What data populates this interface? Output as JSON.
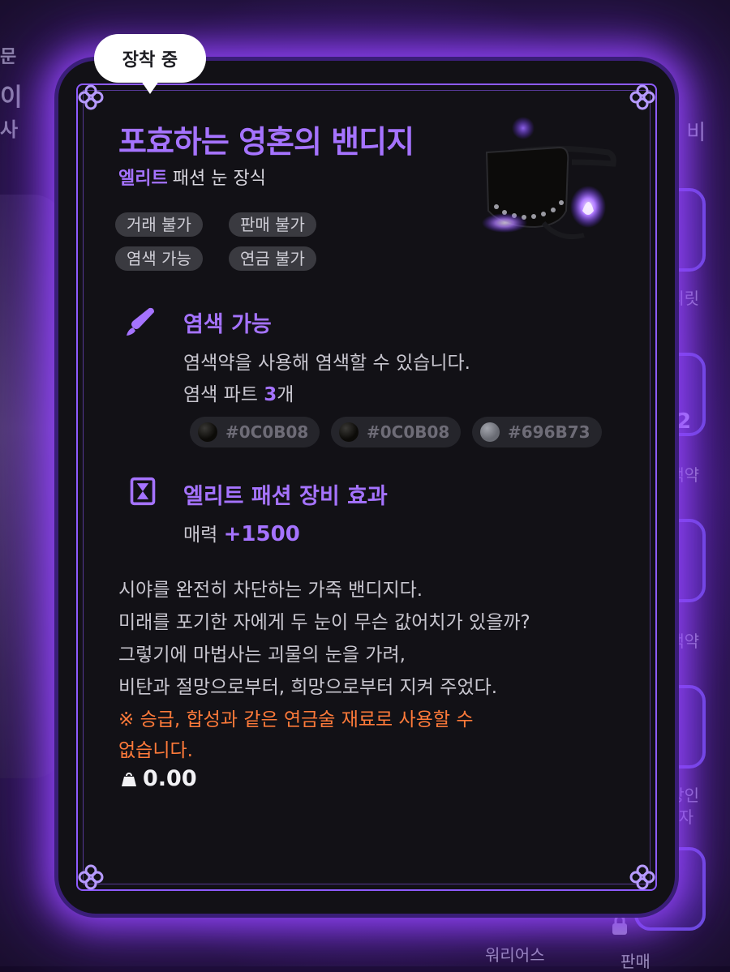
{
  "equip_badge": "장착 중",
  "item": {
    "name": "포효하는 영혼의 밴디지",
    "grade": "엘리트",
    "category": "패션 눈 장식",
    "tags": [
      "거래 불가",
      "판매 불가",
      "염색 가능",
      "연금 불가"
    ]
  },
  "dye": {
    "title": "염색 가능",
    "desc": "염색약을 사용해 염색할 수 있습니다.",
    "parts_prefix": "염색 파트",
    "parts_count": "3",
    "parts_suffix": "개",
    "colors": [
      {
        "hex": "#0C0B08",
        "label": "#0C0B08"
      },
      {
        "hex": "#0C0B08",
        "label": "#0C0B08"
      },
      {
        "hex": "#696B73",
        "label": "#696B73"
      }
    ]
  },
  "effect": {
    "title": "엘리트 패션 장비 효과",
    "stat_label": "매력",
    "stat_value": "+1500"
  },
  "description": [
    "시야를 완전히 차단하는 가죽 밴디지다.",
    "미래를 포기한 자에게 두 눈이 무슨 값어치가 있을까?",
    "그렇기에 마법사는 괴물의 눈을 가려,",
    "비탄과 절망으로부터, 희망으로부터 지켜 주었다."
  ],
  "warning": [
    "※ 승급, 합성과 같은 연금술 재료로 사용할 수",
    "없습니다."
  ],
  "weight": "0.00",
  "background": {
    "left_text": [
      "문",
      "이",
      "사"
    ],
    "right_text": [
      "비",
      "리릿",
      "2",
      "색약",
      "색약",
      "상인",
      "자",
      "워리어스",
      "판매"
    ]
  },
  "colors": {
    "accent": "#A573FF",
    "warning": "#FF7A3A",
    "glow": "#8C3CFF"
  }
}
